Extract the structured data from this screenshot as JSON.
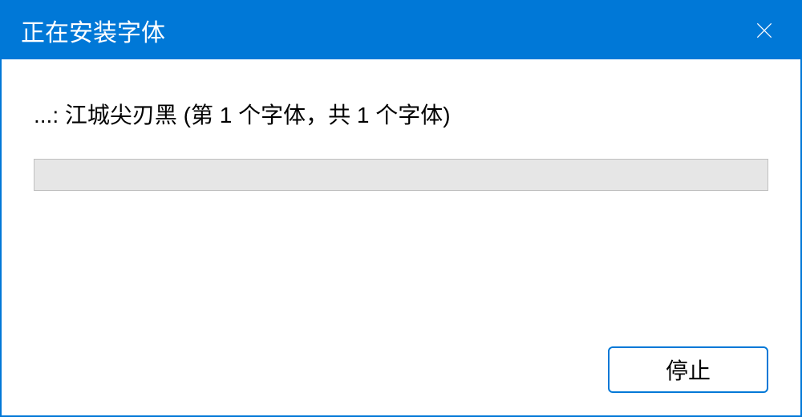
{
  "titlebar": {
    "title": "正在安装字体"
  },
  "content": {
    "status_text": "...: 江城尖刃黑 (第 1 个字体，共 1 个字体)"
  },
  "buttons": {
    "stop_label": "停止"
  }
}
